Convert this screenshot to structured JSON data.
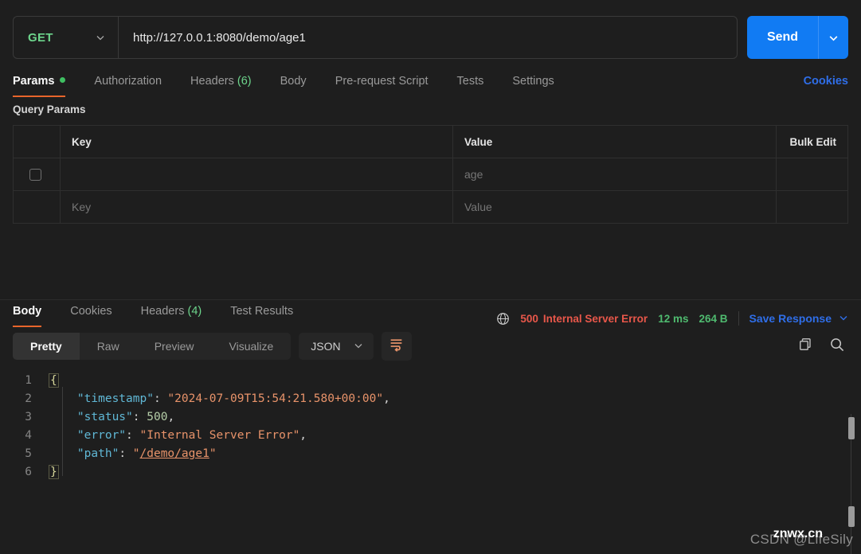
{
  "request": {
    "method": "GET",
    "url": "http://127.0.0.1:8080/demo/age1",
    "send_label": "Send",
    "cookies_label": "Cookies",
    "tabs": [
      {
        "label": "Params",
        "count": "",
        "active": true,
        "dot": true
      },
      {
        "label": "Authorization",
        "count": "",
        "active": false,
        "dot": false
      },
      {
        "label": "Headers",
        "count": "(6)",
        "active": false,
        "dot": false
      },
      {
        "label": "Body",
        "count": "",
        "active": false,
        "dot": false
      },
      {
        "label": "Pre-request Script",
        "count": "",
        "active": false,
        "dot": false
      },
      {
        "label": "Tests",
        "count": "",
        "active": false,
        "dot": false
      },
      {
        "label": "Settings",
        "count": "",
        "active": false,
        "dot": false
      }
    ]
  },
  "query_params": {
    "section_title": "Query Params",
    "columns": {
      "key": "Key",
      "value": "Value",
      "bulk_edit": "Bulk Edit"
    },
    "rows": [
      {
        "checked": false,
        "key": "",
        "value": "age",
        "key_placeholder": "",
        "value_placeholder": ""
      },
      {
        "checked": false,
        "key": "",
        "value": "",
        "key_placeholder": "Key",
        "value_placeholder": "Value"
      }
    ]
  },
  "response": {
    "tabs": [
      {
        "label": "Body",
        "count": "",
        "active": true
      },
      {
        "label": "Cookies",
        "count": "",
        "active": false
      },
      {
        "label": "Headers",
        "count": "(4)",
        "active": false
      },
      {
        "label": "Test Results",
        "count": "",
        "active": false
      }
    ],
    "status_code": "500",
    "status_text": "Internal Server Error",
    "time": "12 ms",
    "size": "264 B",
    "save_response_label": "Save Response",
    "view_modes": [
      "Pretty",
      "Raw",
      "Preview",
      "Visualize"
    ],
    "active_view_mode": "Pretty",
    "format": "JSON"
  },
  "body_code": {
    "lines": [
      "1",
      "2",
      "3",
      "4",
      "5",
      "6"
    ],
    "json": {
      "timestamp": "2024-07-09T15:54:21.580+00:00",
      "status": "500",
      "error": "Internal Server Error",
      "path": "/demo/age1"
    },
    "keys": {
      "timestamp": "\"timestamp\"",
      "status": "\"status\"",
      "error": "\"error\"",
      "path": "\"path\""
    },
    "open_brace": "{",
    "close_brace": "}"
  },
  "watermark": {
    "csdn": "CSDN @LifeSily",
    "znwx": "znwx.cn"
  },
  "colors": {
    "accent_orange": "#e8652b",
    "send_blue": "#117bf3",
    "link_blue": "#2f6ee8",
    "method_green": "#6dd58c",
    "error_red": "#e8574a",
    "ok_green": "#4fba6f",
    "json_key": "#60b8d6",
    "json_string": "#e8936a",
    "json_number": "#b5cea8"
  }
}
